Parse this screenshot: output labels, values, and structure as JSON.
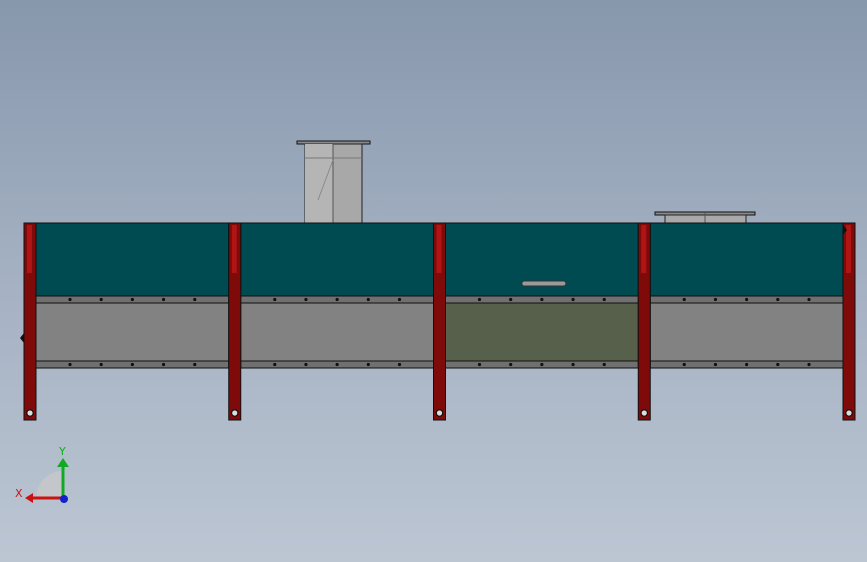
{
  "viewport": {
    "view": "front",
    "background_top": "#8797ac",
    "background_bottom": "#bcc6d3"
  },
  "model": {
    "sections": 4,
    "posts": 5,
    "colors": {
      "upper_panel": "#004a52",
      "lower_panel": "#828282",
      "lower_panel_highlighted": "#57604a",
      "post": "#7f0a0a",
      "post_highlight": "#b01414",
      "duct": "#a9a9a9",
      "rail": "#707070",
      "outline": "#101010"
    },
    "highlighted_section_index": 2,
    "handle_section_index": 2
  },
  "triad": {
    "x_label": "X",
    "y_label": "Y",
    "x_color": "#cc1111",
    "y_color": "#11aa22",
    "z_color": "#1122cc"
  }
}
